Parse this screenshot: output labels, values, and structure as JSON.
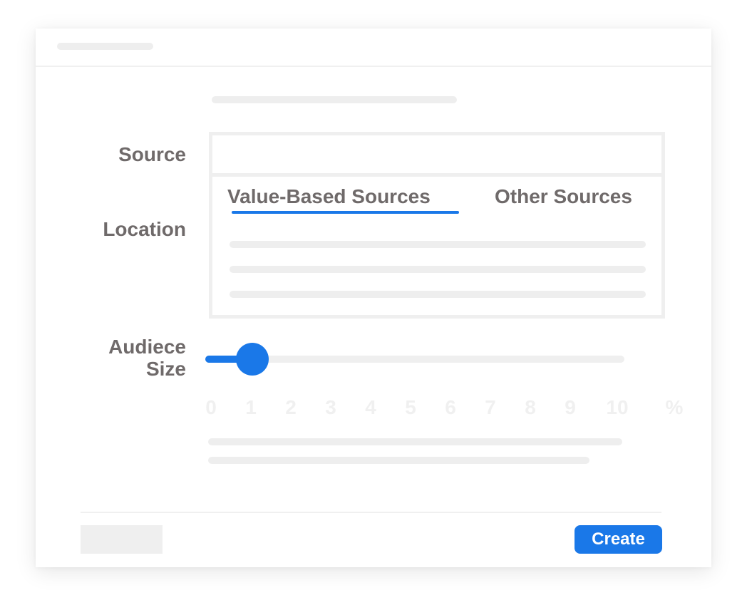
{
  "colors": {
    "accent": "#1a78e8",
    "label_text": "#6f6a6a",
    "placeholder_gray": "#efefef",
    "tick_text": "#f0f0f0"
  },
  "form": {
    "source_label": "Source",
    "location_label": "Location",
    "audience_label_line1": "Audiece",
    "audience_label_line2": "Size"
  },
  "source_tabs": {
    "items": [
      {
        "label": "Value-Based Sources",
        "active": true
      },
      {
        "label": "Other Sources",
        "active": false
      }
    ]
  },
  "audience_slider": {
    "value": 1,
    "min": 0,
    "max": 10,
    "ticks": [
      "0",
      "1",
      "2",
      "3",
      "4",
      "5",
      "6",
      "7",
      "8",
      "9",
      "10"
    ],
    "unit": "%"
  },
  "footer": {
    "create_label": "Create"
  }
}
